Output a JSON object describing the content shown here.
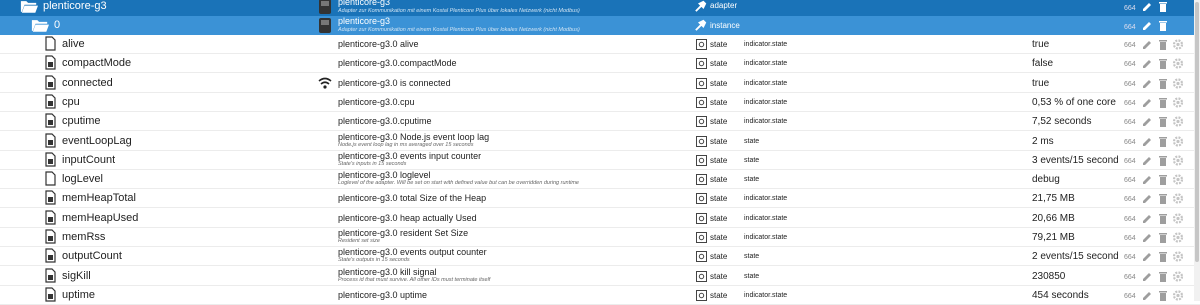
{
  "adapter_row": {
    "id": "plenticore-g3",
    "name": "plenticore-g3",
    "description": "Adapter zur Kommunikation mit einem Kostal Plenticore Plus über lokales Netzwerk (nicht Modbus)",
    "type": "adapter",
    "acl": "664"
  },
  "instance_row": {
    "id": "0",
    "name": "plenticore-g3",
    "description": "Adapter zur Kommunikation mit einem Kostal Plenticore Plus über lokales Netzwerk (nicht Modbus)",
    "type": "instance",
    "acl": "664"
  },
  "objects": [
    {
      "id": "alive",
      "name": "plenticore-g3.0 alive",
      "description": "",
      "type": "state",
      "role": "indicator.state",
      "value": "true",
      "acl": "664",
      "icon": "file-outline-icon"
    },
    {
      "id": "compactMode",
      "name": "plenticore-g3.0.compactMode",
      "description": "",
      "type": "state",
      "role": "indicator.state",
      "value": "false",
      "acl": "664",
      "icon": "file-filled-icon"
    },
    {
      "id": "connected",
      "name": "plenticore-g3.0 is connected",
      "description": "",
      "type": "state",
      "role": "indicator.state",
      "value": "true",
      "acl": "664",
      "icon": "file-filled-icon",
      "extra_icon": "wifi-icon"
    },
    {
      "id": "cpu",
      "name": "plenticore-g3.0.cpu",
      "description": "",
      "type": "state",
      "role": "indicator.state",
      "value": "0,53 % of one core",
      "acl": "664",
      "icon": "file-filled-icon"
    },
    {
      "id": "cputime",
      "name": "plenticore-g3.0.cputime",
      "description": "",
      "type": "state",
      "role": "indicator.state",
      "value": "7,52 seconds",
      "acl": "664",
      "icon": "file-filled-icon"
    },
    {
      "id": "eventLoopLag",
      "name": "plenticore-g3.0 Node.js event loop lag",
      "description": "Node.js event loop lag in ms averaged over 15 seconds",
      "type": "state",
      "role": "state",
      "value": "2 ms",
      "acl": "664",
      "icon": "file-filled-icon"
    },
    {
      "id": "inputCount",
      "name": "plenticore-g3.0 events input counter",
      "description": "State's inputs in 15 seconds",
      "type": "state",
      "role": "state",
      "value": "3 events/15 seconds",
      "acl": "664",
      "icon": "file-filled-icon"
    },
    {
      "id": "logLevel",
      "name": "plenticore-g3.0 loglevel",
      "description": "Loglevel of the adapter. Will be set on start with defined value but can be overridden during runtime",
      "type": "state",
      "role": "state",
      "value": "debug",
      "acl": "664",
      "icon": "file-outline-icon"
    },
    {
      "id": "memHeapTotal",
      "name": "plenticore-g3.0 total Size of the Heap",
      "description": "",
      "type": "state",
      "role": "indicator.state",
      "value": "21,75 MB",
      "acl": "664",
      "icon": "file-filled-icon"
    },
    {
      "id": "memHeapUsed",
      "name": "plenticore-g3.0 heap actually Used",
      "description": "",
      "type": "state",
      "role": "indicator.state",
      "value": "20,66 MB",
      "acl": "664",
      "icon": "file-filled-icon"
    },
    {
      "id": "memRss",
      "name": "plenticore-g3.0 resident Set Size",
      "description": "Resident set size",
      "type": "state",
      "role": "indicator.state",
      "value": "79,21 MB",
      "acl": "664",
      "icon": "file-filled-icon"
    },
    {
      "id": "outputCount",
      "name": "plenticore-g3.0 events output counter",
      "description": "State's outputs in 15 seconds",
      "type": "state",
      "role": "state",
      "value": "2 events/15 seconds",
      "acl": "664",
      "icon": "file-filled-icon"
    },
    {
      "id": "sigKill",
      "name": "plenticore-g3.0 kill signal",
      "description": "Process id that must survive. All other IDs must terminate itself",
      "type": "state",
      "role": "state",
      "value": "230850",
      "acl": "664",
      "icon": "file-filled-icon"
    },
    {
      "id": "uptime",
      "name": "plenticore-g3.0 uptime",
      "description": "",
      "type": "state",
      "role": "indicator.state",
      "value": "454 seconds",
      "acl": "664",
      "icon": "file-filled-icon"
    }
  ],
  "colors": {
    "adapter_row_bg": "#1a73b8",
    "instance_row_bg": "#3b92d6",
    "action_icon": "#9e9e9e"
  }
}
